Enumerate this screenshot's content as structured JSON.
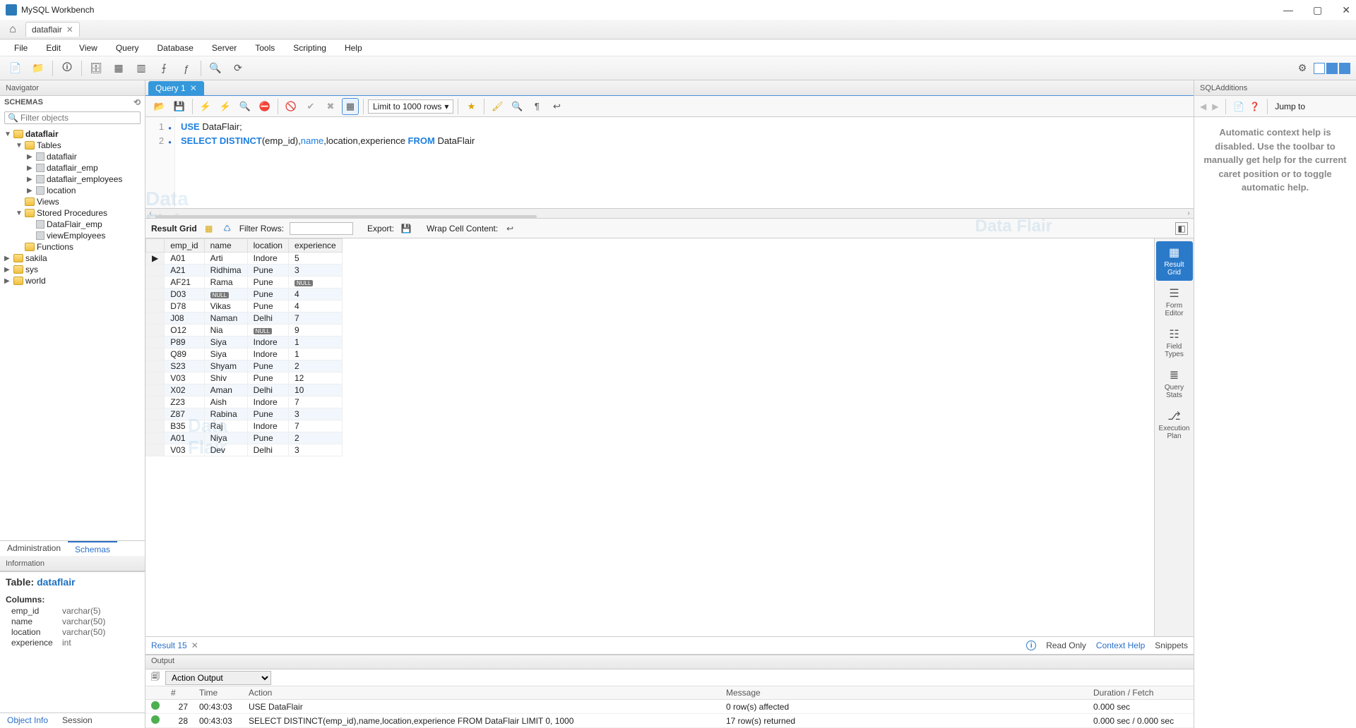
{
  "app_title": "MySQL Workbench",
  "connection_tab": "dataflair",
  "menus": [
    "File",
    "Edit",
    "View",
    "Query",
    "Database",
    "Server",
    "Tools",
    "Scripting",
    "Help"
  ],
  "navigator": {
    "title": "Navigator",
    "schemas_label": "SCHEMAS",
    "filter_placeholder": "Filter objects",
    "tree": {
      "db": "dataflair",
      "tables_label": "Tables",
      "tables": [
        "dataflair",
        "dataflair_emp",
        "dataflair_employees",
        "location"
      ],
      "views_label": "Views",
      "sp_label": "Stored Procedures",
      "stored_procedures": [
        "DataFlair_emp",
        "viewEmployees"
      ],
      "functions_label": "Functions",
      "other_schemas": [
        "sakila",
        "sys",
        "world"
      ]
    },
    "tabs": {
      "administration": "Administration",
      "schemas": "Schemas"
    },
    "information_title": "Information",
    "info": {
      "table_prefix": "Table: ",
      "table_name": "dataflair",
      "columns_label": "Columns:",
      "columns": [
        {
          "name": "emp_id",
          "type": "varchar(5)"
        },
        {
          "name": "name",
          "type": "varchar(50)"
        },
        {
          "name": "location",
          "type": "varchar(50)"
        },
        {
          "name": "experience",
          "type": "int"
        }
      ]
    },
    "bottom_tabs": {
      "object_info": "Object Info",
      "session": "Session"
    }
  },
  "query_tab": "Query 1",
  "editor_toolbar": {
    "limit": "Limit to 1000 rows"
  },
  "sql_lines": [
    {
      "n": "1",
      "html": "<span class='kw'>USE</span> DataFlair;"
    },
    {
      "n": "2",
      "html": "<span class='kw'>SELECT DISTINCT</span>(emp_id),<span class='col'>name</span>,location,experience <span class='kw'>FROM</span> DataFlair"
    }
  ],
  "result_toolbar": {
    "label": "Result Grid",
    "filter_label": "Filter Rows:",
    "export_label": "Export:",
    "wrap_label": "Wrap Cell Content:"
  },
  "columns": [
    "emp_id",
    "name",
    "location",
    "experience"
  ],
  "rows": [
    [
      "A01",
      "Arti",
      "Indore",
      "5"
    ],
    [
      "A21",
      "Ridhima",
      "Pune",
      "3"
    ],
    [
      "AF21",
      "Rama",
      "Pune",
      "NULL"
    ],
    [
      "D03",
      "NULL",
      "Pune",
      "4"
    ],
    [
      "D78",
      "Vikas",
      "Pune",
      "4"
    ],
    [
      "J08",
      "Naman",
      "Delhi",
      "7"
    ],
    [
      "O12",
      "Nia",
      "NULL",
      "9"
    ],
    [
      "P89",
      "Siya",
      "Indore",
      "1"
    ],
    [
      "Q89",
      "Siya",
      "Indore",
      "1"
    ],
    [
      "S23",
      "Shyam",
      "Pune",
      "2"
    ],
    [
      "V03",
      "Shiv",
      "Pune",
      "12"
    ],
    [
      "X02",
      "Aman",
      "Delhi",
      "10"
    ],
    [
      "Z23",
      "Aish",
      "Indore",
      "7"
    ],
    [
      "Z87",
      "Rabina",
      "Pune",
      "3"
    ],
    [
      "B35",
      "Raj",
      "Indore",
      "7"
    ],
    [
      "A01",
      "Niya",
      "Pune",
      "2"
    ],
    [
      "V03",
      "Dev",
      "Delhi",
      "3"
    ]
  ],
  "result_side": {
    "result_grid": "Result\nGrid",
    "form_editor": "Form\nEditor",
    "field_types": "Field\nTypes",
    "query_stats": "Query\nStats",
    "exec_plan": "Execution\nPlan"
  },
  "result_tab": "Result 15",
  "readonly": "Read Only",
  "context_help_tab": "Context Help",
  "snippets_tab": "Snippets",
  "output": {
    "title": "Output",
    "selector": "Action Output",
    "headers": [
      "",
      "#",
      "Time",
      "Action",
      "Message",
      "Duration / Fetch"
    ],
    "rows": [
      {
        "n": "27",
        "time": "00:43:03",
        "action": "USE DataFlair",
        "msg": "0 row(s) affected",
        "dur": "0.000 sec"
      },
      {
        "n": "28",
        "time": "00:43:03",
        "action": "SELECT DISTINCT(emp_id),name,location,experience FROM DataFlair LIMIT 0, 1000",
        "msg": "17 row(s) returned",
        "dur": "0.000 sec / 0.000 sec"
      }
    ]
  },
  "right": {
    "title": "SQLAdditions",
    "jump": "Jump to",
    "help_text": "Automatic context help is disabled. Use the toolbar to manually get help for the current caret position or to toggle automatic help."
  }
}
